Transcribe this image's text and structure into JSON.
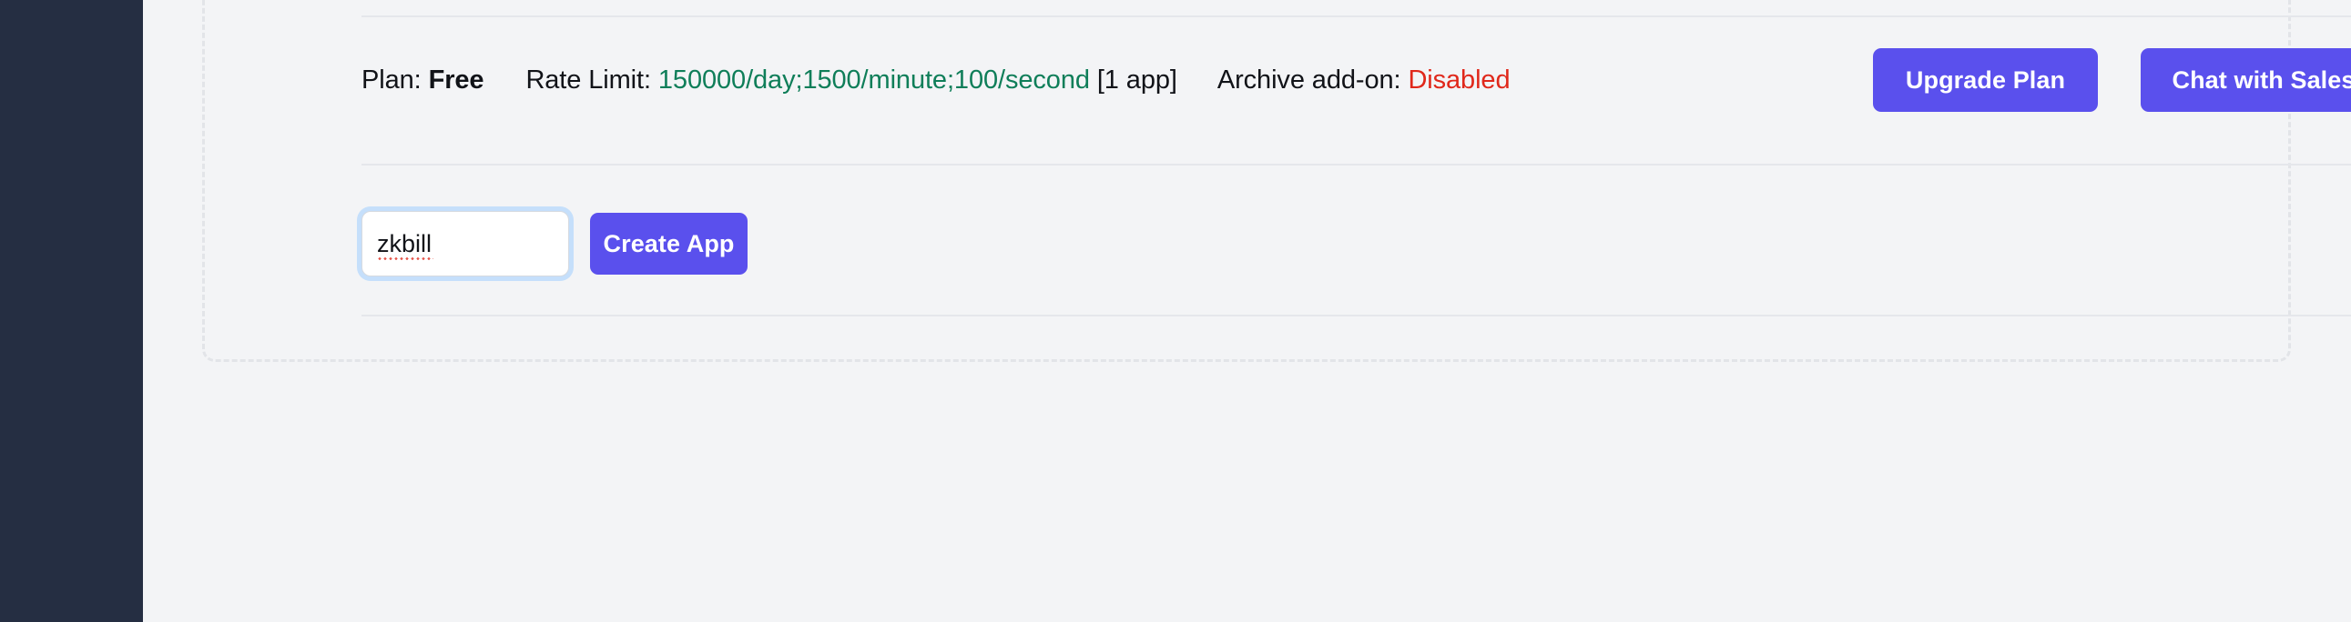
{
  "sidebar": {
    "label": "navigation-sidebar",
    "background": "#252E42"
  },
  "theme": {
    "page_background": "#F3F4F6",
    "accent_purple": "#5A50ED",
    "value_green": "#0F7E59",
    "value_red": "#E0281B",
    "focus_ring_blue": "#C5DFFB",
    "divider_gray": "#E5E7EB",
    "dashed_border_gray": "#E2E4E8"
  },
  "plan_bar": {
    "plan_label": "Plan:",
    "plan_value": "Free",
    "rate_limit_label": "Rate Limit:",
    "rate_limit_value": "150000/day;1500/minute;100/second",
    "app_count": "[1 app]",
    "archive_label": "Archive add-on:",
    "archive_value": "Disabled",
    "upgrade_button": "Upgrade Plan",
    "chat_button": "Chat with Sales"
  },
  "create_app": {
    "input_value": "zkbill",
    "input_placeholder": "App name",
    "create_button": "Create App"
  }
}
